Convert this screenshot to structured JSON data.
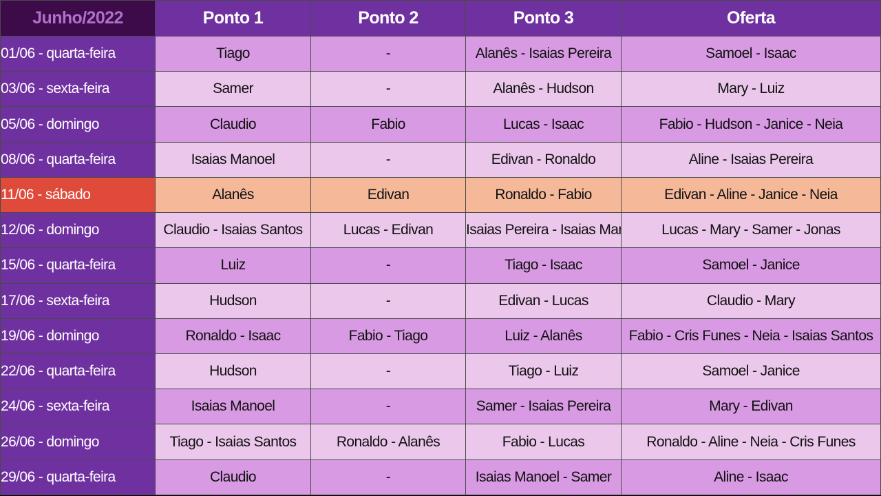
{
  "schedule": {
    "month_label": "Junho/2022",
    "columns": [
      "Ponto 1",
      "Ponto 2",
      "Ponto 3",
      "Oferta"
    ],
    "colors": {
      "header_bg": "#7031a0",
      "month_header_bg": "#3d0a4a",
      "month_header_text": "#b070c8",
      "row_odd_bg": "#d89ae3",
      "row_even_bg": "#ebc7eb",
      "highlight_row_bg": "#f5b99a",
      "highlight_date_bg": "#e04a3a"
    },
    "highlighted_row_index": 4,
    "rows": [
      {
        "date": "01/06 - quarta-feira",
        "ponto1": "Tiago",
        "ponto2": "-",
        "ponto3": "Alanês - Isaias Pereira",
        "oferta": "Samoel - Isaac"
      },
      {
        "date": "03/06 - sexta-feira",
        "ponto1": "Samer",
        "ponto2": "-",
        "ponto3": "Alanês - Hudson",
        "oferta": "Mary - Luiz"
      },
      {
        "date": "05/06 - domingo",
        "ponto1": "Claudio",
        "ponto2": "Fabio",
        "ponto3": "Lucas - Isaac",
        "oferta": "Fabio - Hudson - Janice - Neia"
      },
      {
        "date": "08/06 - quarta-feira",
        "ponto1": "Isaias Manoel",
        "ponto2": "-",
        "ponto3": "Edivan - Ronaldo",
        "oferta": "Aline - Isaias Pereira"
      },
      {
        "date": "11/06 - sábado",
        "ponto1": "Alanês",
        "ponto2": "Edivan",
        "ponto3": "Ronaldo - Fabio",
        "oferta": "Edivan - Aline - Janice - Neia"
      },
      {
        "date": "12/06 - domingo",
        "ponto1": "Claudio - Isaias Santos",
        "ponto2": "Lucas - Edivan",
        "ponto3": "Isaias Pereira - Isaias Manoel",
        "oferta": "Lucas - Mary - Samer - Jonas"
      },
      {
        "date": "15/06 - quarta-feira",
        "ponto1": "Luiz",
        "ponto2": "-",
        "ponto3": "Tiago - Isaac",
        "oferta": "Samoel - Janice"
      },
      {
        "date": "17/06 - sexta-feira",
        "ponto1": "Hudson",
        "ponto2": "-",
        "ponto3": "Edivan - Lucas",
        "oferta": "Claudio - Mary"
      },
      {
        "date": "19/06 - domingo",
        "ponto1": "Ronaldo - Isaac",
        "ponto2": "Fabio - Tiago",
        "ponto3": "Luiz - Alanês",
        "oferta": "Fabio - Cris Funes - Neia - Isaias Santos"
      },
      {
        "date": "22/06 - quarta-feira",
        "ponto1": "Hudson",
        "ponto2": "-",
        "ponto3": "Tiago - Luiz",
        "oferta": "Samoel - Janice"
      },
      {
        "date": "24/06 - sexta-feira",
        "ponto1": "Isaias Manoel",
        "ponto2": "-",
        "ponto3": "Samer - Isaias Pereira",
        "oferta": "Mary - Edivan"
      },
      {
        "date": "26/06 - domingo",
        "ponto1": "Tiago - Isaias Santos",
        "ponto2": "Ronaldo - Alanês",
        "ponto3": "Fabio - Lucas",
        "oferta": "Ronaldo - Aline - Neia - Cris Funes"
      },
      {
        "date": "29/06 - quarta-feira",
        "ponto1": "Claudio",
        "ponto2": "-",
        "ponto3": "Isaias Manoel - Samer",
        "oferta": "Aline - Isaac"
      }
    ]
  }
}
